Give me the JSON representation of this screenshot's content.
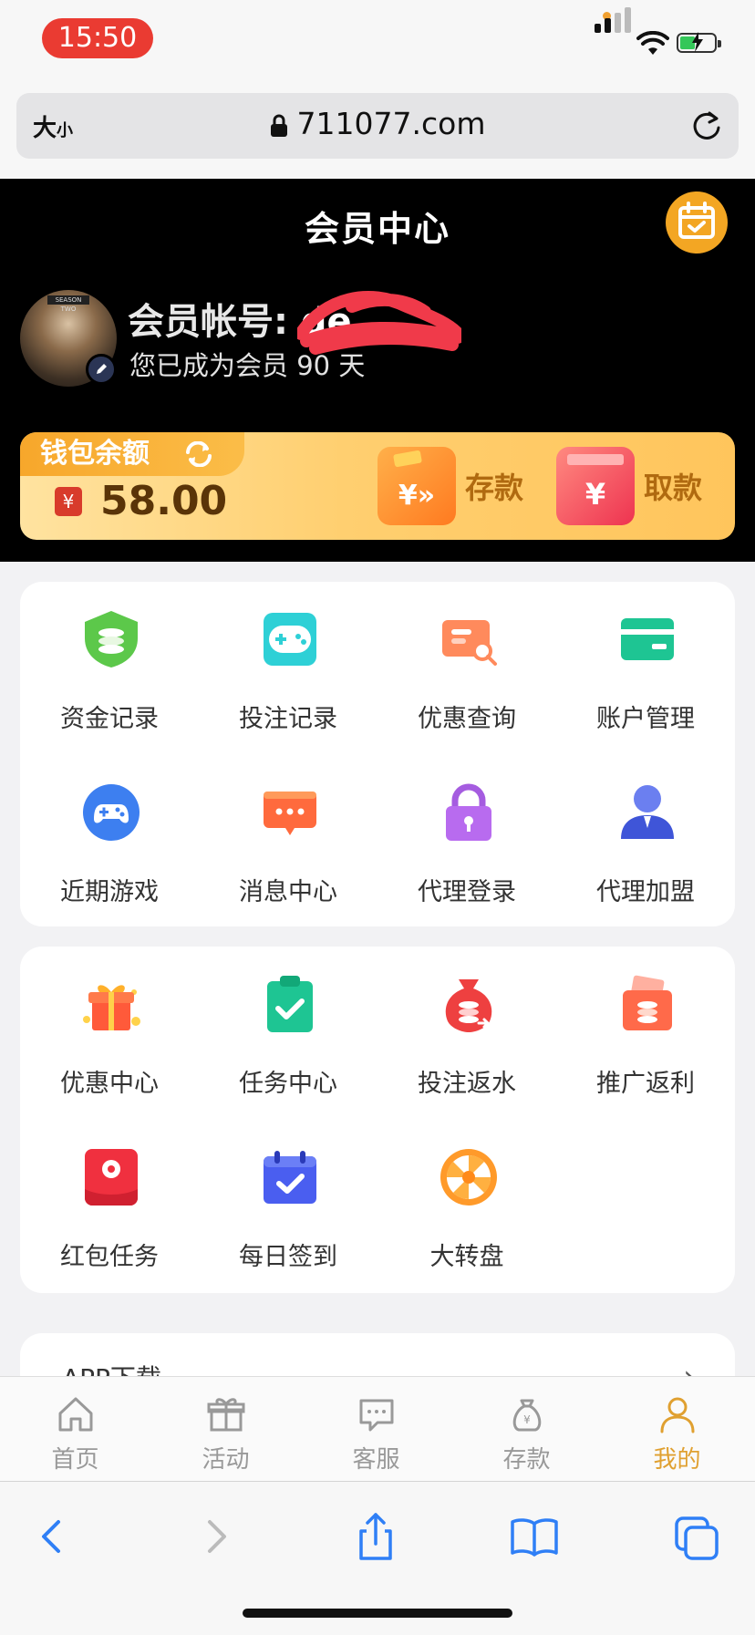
{
  "status": {
    "time": "15:50"
  },
  "browser": {
    "text_size_label_big": "大",
    "text_size_label_small": "小",
    "url": "711077.com"
  },
  "header": {
    "title": "会员中心",
    "account_prefix": "会员帐号: ",
    "account_visible": "de",
    "member_days_text": "您已成为会员 90 天"
  },
  "wallet": {
    "label": "钱包余额",
    "balance": "58.00",
    "deposit_label": "存款",
    "withdraw_label": "取款"
  },
  "grid1": [
    {
      "label": "资金记录",
      "icon": "shield-coin-icon"
    },
    {
      "label": "投注记录",
      "icon": "gamepad-icon"
    },
    {
      "label": "优惠查询",
      "icon": "ticket-search-icon"
    },
    {
      "label": "账户管理",
      "icon": "card-icon"
    },
    {
      "label": "近期游戏",
      "icon": "controller-icon"
    },
    {
      "label": "消息中心",
      "icon": "message-icon"
    },
    {
      "label": "代理登录",
      "icon": "lock-icon"
    },
    {
      "label": "代理加盟",
      "icon": "agent-icon"
    }
  ],
  "grid2": [
    {
      "label": "优惠中心",
      "icon": "gift-icon"
    },
    {
      "label": "任务中心",
      "icon": "clipboard-check-icon"
    },
    {
      "label": "投注返水",
      "icon": "coin-bag-icon"
    },
    {
      "label": "推广返利",
      "icon": "envelope-coin-icon"
    },
    {
      "label": "红包任务",
      "icon": "red-packet-icon"
    },
    {
      "label": "每日签到",
      "icon": "calendar-check-icon"
    },
    {
      "label": "大转盘",
      "icon": "wheel-icon"
    }
  ],
  "app_download": {
    "label": "APP下载"
  },
  "tabbar": [
    {
      "label": "首页",
      "icon": "home-icon"
    },
    {
      "label": "活动",
      "icon": "gift-outline-icon"
    },
    {
      "label": "客服",
      "icon": "chat-icon"
    },
    {
      "label": "存款",
      "icon": "money-bag-icon"
    },
    {
      "label": "我的",
      "icon": "user-icon",
      "active": true
    }
  ],
  "colors": {
    "accent": "#e0a030",
    "header_bg": "#000000",
    "time_pill": "#ea3b32"
  }
}
